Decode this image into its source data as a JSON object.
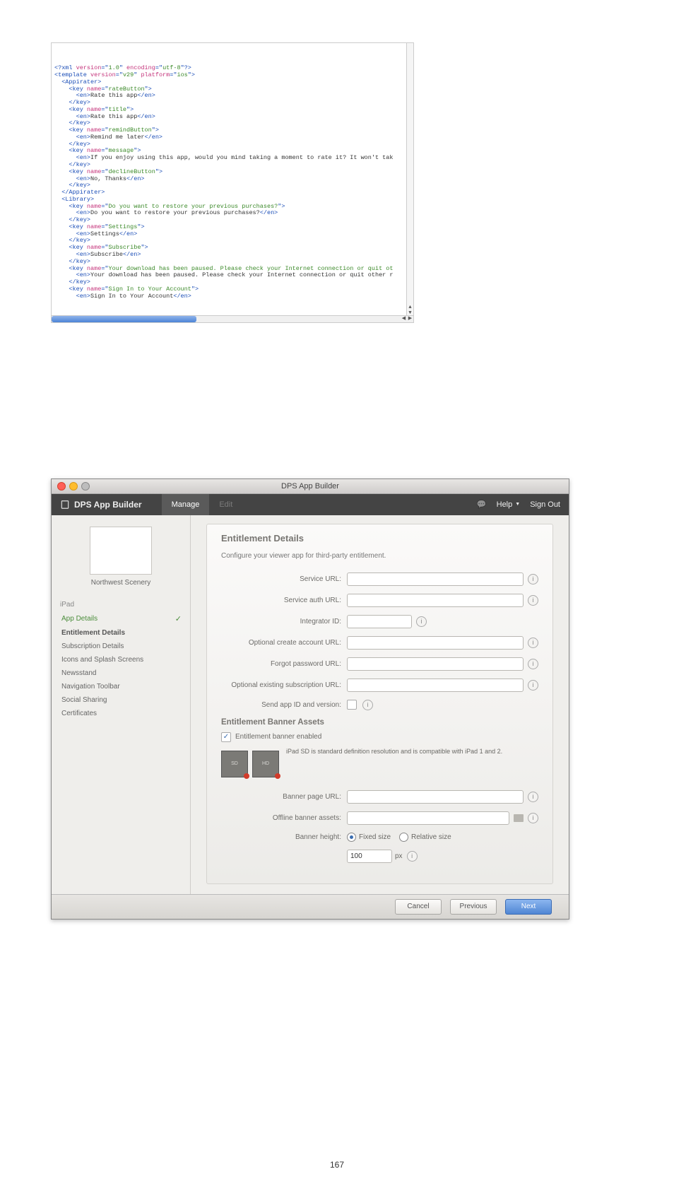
{
  "page_number": "167",
  "code": {
    "lines": [
      {
        "parts": [
          [
            "blue",
            "<?xml "
          ],
          [
            "pink",
            "version"
          ],
          [
            "blue",
            "=\""
          ],
          [
            "green",
            "1.0"
          ],
          [
            "blue",
            "\" "
          ],
          [
            "pink",
            "encoding"
          ],
          [
            "blue",
            "=\""
          ],
          [
            "green",
            "utf-8"
          ],
          [
            "blue",
            "\"?>"
          ]
        ]
      },
      {
        "parts": [
          [
            "blue",
            "<template "
          ],
          [
            "pink",
            "version"
          ],
          [
            "blue",
            "=\""
          ],
          [
            "green",
            "v29"
          ],
          [
            "blue",
            "\" "
          ],
          [
            "pink",
            "platform"
          ],
          [
            "blue",
            "=\""
          ],
          [
            "green",
            "ios"
          ],
          [
            "blue",
            "\">"
          ]
        ]
      },
      {
        "parts": [
          [
            "blue",
            "  <Appirater>"
          ]
        ]
      },
      {
        "parts": [
          [
            "blue",
            "    <key "
          ],
          [
            "pink",
            "name"
          ],
          [
            "blue",
            "=\""
          ],
          [
            "green",
            "rateButton"
          ],
          [
            "blue",
            "\">"
          ]
        ]
      },
      {
        "parts": [
          [
            "blue",
            "      <en>"
          ],
          [
            "plain",
            "Rate this app"
          ],
          [
            "blue",
            "</en>"
          ]
        ]
      },
      {
        "parts": [
          [
            "blue",
            "    </key>"
          ]
        ]
      },
      {
        "parts": [
          [
            "blue",
            "    <key "
          ],
          [
            "pink",
            "name"
          ],
          [
            "blue",
            "=\""
          ],
          [
            "green",
            "title"
          ],
          [
            "blue",
            "\">"
          ]
        ]
      },
      {
        "parts": [
          [
            "blue",
            "      <en>"
          ],
          [
            "plain",
            "Rate this app"
          ],
          [
            "blue",
            "</en>"
          ]
        ]
      },
      {
        "parts": [
          [
            "blue",
            "    </key>"
          ]
        ]
      },
      {
        "parts": [
          [
            "blue",
            "    <key "
          ],
          [
            "pink",
            "name"
          ],
          [
            "blue",
            "=\""
          ],
          [
            "green",
            "remindButton"
          ],
          [
            "blue",
            "\">"
          ]
        ]
      },
      {
        "parts": [
          [
            "blue",
            "      <en>"
          ],
          [
            "plain",
            "Remind me later"
          ],
          [
            "blue",
            "</en>"
          ]
        ]
      },
      {
        "parts": [
          [
            "blue",
            "    </key>"
          ]
        ]
      },
      {
        "parts": [
          [
            "blue",
            "    <key "
          ],
          [
            "pink",
            "name"
          ],
          [
            "blue",
            "=\""
          ],
          [
            "green",
            "message"
          ],
          [
            "blue",
            "\">"
          ]
        ]
      },
      {
        "parts": [
          [
            "blue",
            "      <en>"
          ],
          [
            "plain",
            "If you enjoy using this app, would you mind taking a moment to rate it? It won't tak"
          ]
        ]
      },
      {
        "parts": [
          [
            "blue",
            "    </key>"
          ]
        ]
      },
      {
        "parts": [
          [
            "blue",
            "    <key "
          ],
          [
            "pink",
            "name"
          ],
          [
            "blue",
            "=\""
          ],
          [
            "green",
            "declineButton"
          ],
          [
            "blue",
            "\">"
          ]
        ]
      },
      {
        "parts": [
          [
            "blue",
            "      <en>"
          ],
          [
            "plain",
            "No, Thanks"
          ],
          [
            "blue",
            "</en>"
          ]
        ]
      },
      {
        "parts": [
          [
            "blue",
            "    </key>"
          ]
        ]
      },
      {
        "parts": [
          [
            "blue",
            "  </Appirater>"
          ]
        ]
      },
      {
        "parts": [
          [
            "blue",
            "  <Library>"
          ]
        ]
      },
      {
        "parts": [
          [
            "blue",
            "    <key "
          ],
          [
            "pink",
            "name"
          ],
          [
            "blue",
            "=\""
          ],
          [
            "green",
            "Do you want to restore your previous purchases?"
          ],
          [
            "blue",
            "\">"
          ]
        ]
      },
      {
        "parts": [
          [
            "blue",
            "      <en>"
          ],
          [
            "plain",
            "Do you want to restore your previous purchases?"
          ],
          [
            "blue",
            "</en>"
          ]
        ]
      },
      {
        "parts": [
          [
            "blue",
            "    </key>"
          ]
        ]
      },
      {
        "parts": [
          [
            "blue",
            "    <key "
          ],
          [
            "pink",
            "name"
          ],
          [
            "blue",
            "=\""
          ],
          [
            "green",
            "Settings"
          ],
          [
            "blue",
            "\">"
          ]
        ]
      },
      {
        "parts": [
          [
            "blue",
            "      <en>"
          ],
          [
            "plain",
            "Settings"
          ],
          [
            "blue",
            "</en>"
          ]
        ]
      },
      {
        "parts": [
          [
            "blue",
            "    </key>"
          ]
        ]
      },
      {
        "parts": [
          [
            "blue",
            "    <key "
          ],
          [
            "pink",
            "name"
          ],
          [
            "blue",
            "=\""
          ],
          [
            "green",
            "Subscribe"
          ],
          [
            "blue",
            "\">"
          ]
        ]
      },
      {
        "parts": [
          [
            "blue",
            "      <en>"
          ],
          [
            "plain",
            "Subscribe"
          ],
          [
            "blue",
            "</en>"
          ]
        ]
      },
      {
        "parts": [
          [
            "blue",
            "    </key>"
          ]
        ]
      },
      {
        "parts": [
          [
            "blue",
            "    <key "
          ],
          [
            "pink",
            "name"
          ],
          [
            "blue",
            "=\""
          ],
          [
            "green",
            "Your download has been paused. Please check your Internet connection or quit ot"
          ]
        ]
      },
      {
        "parts": [
          [
            "blue",
            "      <en>"
          ],
          [
            "plain",
            "Your download has been paused. Please check your Internet connection or quit other r"
          ]
        ]
      },
      {
        "parts": [
          [
            "blue",
            "    </key>"
          ]
        ]
      },
      {
        "parts": [
          [
            "blue",
            "    <key "
          ],
          [
            "pink",
            "name"
          ],
          [
            "blue",
            "=\""
          ],
          [
            "green",
            "Sign In to Your Account"
          ],
          [
            "blue",
            "\">"
          ]
        ]
      },
      {
        "parts": [
          [
            "blue",
            "      <en>"
          ],
          [
            "plain",
            "Sign In to Your Account"
          ],
          [
            "blue",
            "</en>"
          ]
        ]
      }
    ]
  },
  "win": {
    "title": "DPS App Builder",
    "brand": "DPS App Builder",
    "tabs": {
      "manage": "Manage",
      "edit": "Edit"
    },
    "help": "Help",
    "signout": "Sign Out",
    "thumb_caption": "Northwest Scenery",
    "sb_section": "iPad",
    "sb_items": [
      {
        "label": "App Details",
        "active": true
      },
      {
        "label": "Entitlement Details",
        "heading": true
      },
      {
        "label": "Subscription Details"
      },
      {
        "label": "Icons and Splash Screens"
      },
      {
        "label": "Newsstand"
      },
      {
        "label": "Navigation Toolbar"
      },
      {
        "label": "Social Sharing"
      },
      {
        "label": "Certificates"
      }
    ],
    "panel": {
      "h1": "Entitlement Details",
      "sub": "Configure your viewer app for third-party entitlement.",
      "labels": {
        "service_url": "Service URL:",
        "service_auth_url": "Service auth URL:",
        "integrator_id": "Integrator ID:",
        "create_account": "Optional create account URL:",
        "forgot_password": "Forgot password URL:",
        "existing_sub": "Optional existing subscription URL:",
        "send_app": "Send app ID and version:",
        "h2": "Entitlement Banner Assets",
        "banner_enabled": "Entitlement banner enabled",
        "asset_note": "iPad SD is standard definition resolution and is compatible with iPad 1 and 2.",
        "banner_page_url": "Banner page URL:",
        "offline_assets": "Offline banner assets:",
        "banner_height": "Banner height:",
        "fixed": "Fixed size",
        "relative": "Relative size",
        "height_value": "100",
        "px": "px"
      },
      "assets": [
        "SD",
        "HD"
      ]
    },
    "footer": {
      "cancel": "Cancel",
      "previous": "Previous",
      "next": "Next"
    }
  }
}
